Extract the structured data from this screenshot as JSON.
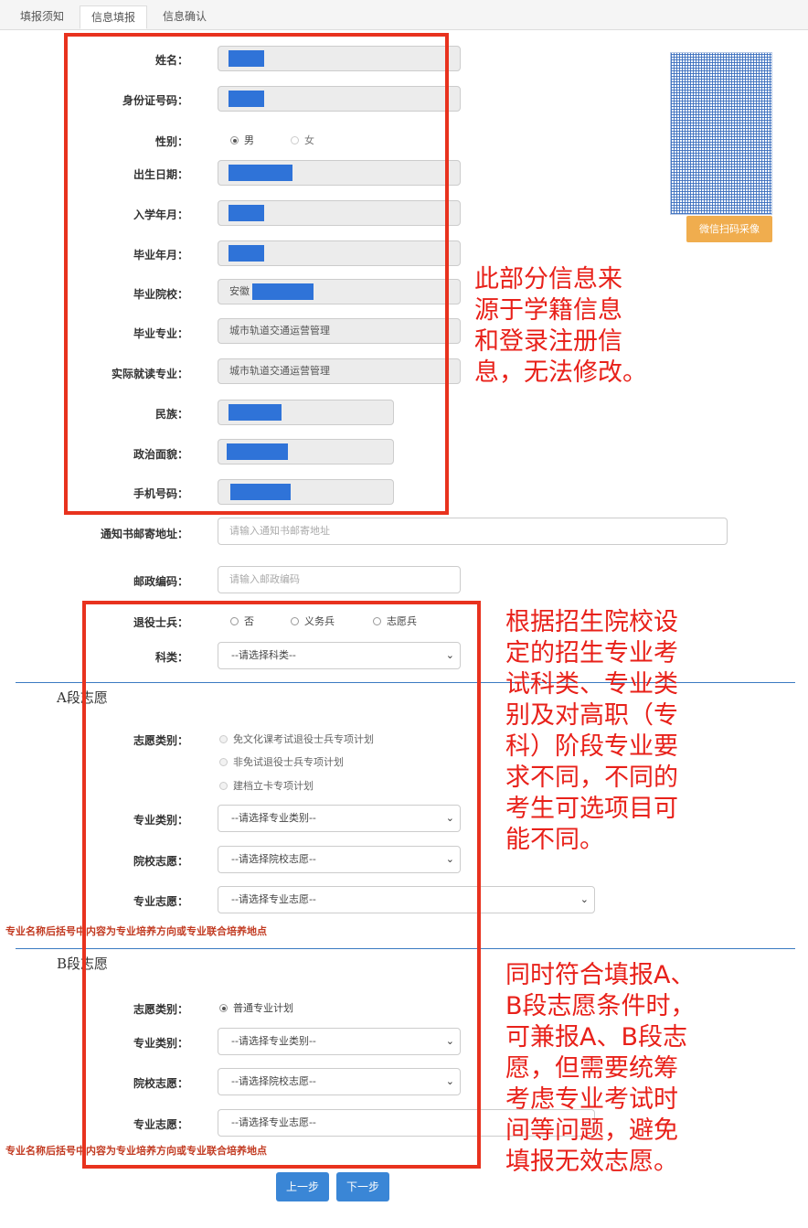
{
  "tabs": [
    "填报须知",
    "信息填报",
    "信息确认"
  ],
  "fields": {
    "name": "姓名：",
    "id_number": "身份证号码：",
    "gender": "性别：",
    "birth_date": "出生日期：",
    "enroll_month": "入学年月：",
    "graduate_month": "毕业年月：",
    "grad_school": "毕业院校：",
    "grad_major": "毕业专业：",
    "actual_major": "实际就读专业：",
    "ethnicity": "民族：",
    "politics": "政治面貌：",
    "phone": "手机号码：",
    "mail_address": "通知书邮寄地址：",
    "postcode": "邮政编码：",
    "veteran": "退役士兵：",
    "subject_type": "科类："
  },
  "values": {
    "gender_options": [
      "男",
      "女"
    ],
    "grad_school_prefix": "安徽",
    "grad_major": "城市轨道交通运营管理",
    "actual_major": "城市轨道交通运营管理",
    "veteran_options": [
      "否",
      "义务兵",
      "志愿兵"
    ]
  },
  "placeholders": {
    "mail_address": "请输入通知书邮寄地址",
    "postcode": "请输入邮政编码"
  },
  "selects": {
    "subject_type": "--请选择科类--",
    "major_category": "--请选择专业类别--",
    "school_choice": "--请选择院校志愿--",
    "major_choice": "--请选择专业志愿--"
  },
  "photo": {
    "button": "微信扫码采像"
  },
  "section_a": {
    "title": "A段志愿",
    "type_label": "志愿类别：",
    "type_options": [
      "免文化课考试退役士兵专项计划",
      "非免试退役士兵专项计划",
      "建档立卡专项计划"
    ],
    "category_label": "专业类别：",
    "school_label": "院校志愿：",
    "major_label": "专业志愿：",
    "note": "专业名称后括号中内容为专业培养方向或专业联合培养地点"
  },
  "section_b": {
    "title": "B段志愿",
    "type_label": "志愿类别：",
    "type_options": [
      "普通专业计划"
    ],
    "category_label": "专业类别：",
    "school_label": "院校志愿：",
    "major_label": "专业志愿：",
    "note": "专业名称后括号中内容为专业培养方向或专业联合培养地点"
  },
  "buttons": {
    "prev": "上一步",
    "next": "下一步"
  },
  "annotations": {
    "readonly": "此部分信息来\n源于学籍信息\n和登录注册信\n息，无法修改。",
    "options": "根据招生院校设\n定的招生专业考\n试科类、专业类\n别及对高职（专\n科）阶段专业要\n求不同，不同的\n考生可选项目可\n能不同。",
    "both": "同时符合填报A、\nB段志愿条件时，\n可兼报A、B段志\n愿，但需要统筹\n考虑专业考试时\n间等问题，避免\n填报无效志愿。"
  },
  "colors": {
    "annotation_red": "#e8211a",
    "primary": "#3a86d6",
    "warning": "#f0ad4e"
  }
}
